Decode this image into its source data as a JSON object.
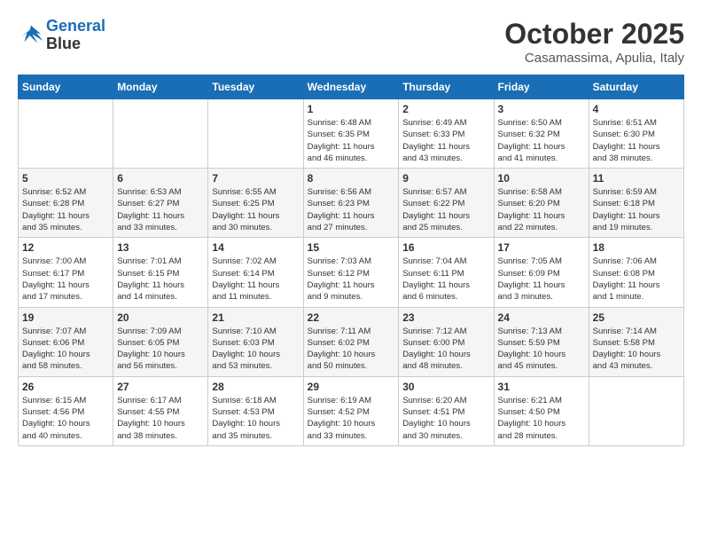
{
  "header": {
    "logo_line1": "General",
    "logo_line2": "Blue",
    "month": "October 2025",
    "location": "Casamassima, Apulia, Italy"
  },
  "weekdays": [
    "Sunday",
    "Monday",
    "Tuesday",
    "Wednesday",
    "Thursday",
    "Friday",
    "Saturday"
  ],
  "weeks": [
    [
      {
        "day": "",
        "info": ""
      },
      {
        "day": "",
        "info": ""
      },
      {
        "day": "",
        "info": ""
      },
      {
        "day": "1",
        "info": "Sunrise: 6:48 AM\nSunset: 6:35 PM\nDaylight: 11 hours\nand 46 minutes."
      },
      {
        "day": "2",
        "info": "Sunrise: 6:49 AM\nSunset: 6:33 PM\nDaylight: 11 hours\nand 43 minutes."
      },
      {
        "day": "3",
        "info": "Sunrise: 6:50 AM\nSunset: 6:32 PM\nDaylight: 11 hours\nand 41 minutes."
      },
      {
        "day": "4",
        "info": "Sunrise: 6:51 AM\nSunset: 6:30 PM\nDaylight: 11 hours\nand 38 minutes."
      }
    ],
    [
      {
        "day": "5",
        "info": "Sunrise: 6:52 AM\nSunset: 6:28 PM\nDaylight: 11 hours\nand 35 minutes."
      },
      {
        "day": "6",
        "info": "Sunrise: 6:53 AM\nSunset: 6:27 PM\nDaylight: 11 hours\nand 33 minutes."
      },
      {
        "day": "7",
        "info": "Sunrise: 6:55 AM\nSunset: 6:25 PM\nDaylight: 11 hours\nand 30 minutes."
      },
      {
        "day": "8",
        "info": "Sunrise: 6:56 AM\nSunset: 6:23 PM\nDaylight: 11 hours\nand 27 minutes."
      },
      {
        "day": "9",
        "info": "Sunrise: 6:57 AM\nSunset: 6:22 PM\nDaylight: 11 hours\nand 25 minutes."
      },
      {
        "day": "10",
        "info": "Sunrise: 6:58 AM\nSunset: 6:20 PM\nDaylight: 11 hours\nand 22 minutes."
      },
      {
        "day": "11",
        "info": "Sunrise: 6:59 AM\nSunset: 6:18 PM\nDaylight: 11 hours\nand 19 minutes."
      }
    ],
    [
      {
        "day": "12",
        "info": "Sunrise: 7:00 AM\nSunset: 6:17 PM\nDaylight: 11 hours\nand 17 minutes."
      },
      {
        "day": "13",
        "info": "Sunrise: 7:01 AM\nSunset: 6:15 PM\nDaylight: 11 hours\nand 14 minutes."
      },
      {
        "day": "14",
        "info": "Sunrise: 7:02 AM\nSunset: 6:14 PM\nDaylight: 11 hours\nand 11 minutes."
      },
      {
        "day": "15",
        "info": "Sunrise: 7:03 AM\nSunset: 6:12 PM\nDaylight: 11 hours\nand 9 minutes."
      },
      {
        "day": "16",
        "info": "Sunrise: 7:04 AM\nSunset: 6:11 PM\nDaylight: 11 hours\nand 6 minutes."
      },
      {
        "day": "17",
        "info": "Sunrise: 7:05 AM\nSunset: 6:09 PM\nDaylight: 11 hours\nand 3 minutes."
      },
      {
        "day": "18",
        "info": "Sunrise: 7:06 AM\nSunset: 6:08 PM\nDaylight: 11 hours\nand 1 minute."
      }
    ],
    [
      {
        "day": "19",
        "info": "Sunrise: 7:07 AM\nSunset: 6:06 PM\nDaylight: 10 hours\nand 58 minutes."
      },
      {
        "day": "20",
        "info": "Sunrise: 7:09 AM\nSunset: 6:05 PM\nDaylight: 10 hours\nand 56 minutes."
      },
      {
        "day": "21",
        "info": "Sunrise: 7:10 AM\nSunset: 6:03 PM\nDaylight: 10 hours\nand 53 minutes."
      },
      {
        "day": "22",
        "info": "Sunrise: 7:11 AM\nSunset: 6:02 PM\nDaylight: 10 hours\nand 50 minutes."
      },
      {
        "day": "23",
        "info": "Sunrise: 7:12 AM\nSunset: 6:00 PM\nDaylight: 10 hours\nand 48 minutes."
      },
      {
        "day": "24",
        "info": "Sunrise: 7:13 AM\nSunset: 5:59 PM\nDaylight: 10 hours\nand 45 minutes."
      },
      {
        "day": "25",
        "info": "Sunrise: 7:14 AM\nSunset: 5:58 PM\nDaylight: 10 hours\nand 43 minutes."
      }
    ],
    [
      {
        "day": "26",
        "info": "Sunrise: 6:15 AM\nSunset: 4:56 PM\nDaylight: 10 hours\nand 40 minutes."
      },
      {
        "day": "27",
        "info": "Sunrise: 6:17 AM\nSunset: 4:55 PM\nDaylight: 10 hours\nand 38 minutes."
      },
      {
        "day": "28",
        "info": "Sunrise: 6:18 AM\nSunset: 4:53 PM\nDaylight: 10 hours\nand 35 minutes."
      },
      {
        "day": "29",
        "info": "Sunrise: 6:19 AM\nSunset: 4:52 PM\nDaylight: 10 hours\nand 33 minutes."
      },
      {
        "day": "30",
        "info": "Sunrise: 6:20 AM\nSunset: 4:51 PM\nDaylight: 10 hours\nand 30 minutes."
      },
      {
        "day": "31",
        "info": "Sunrise: 6:21 AM\nSunset: 4:50 PM\nDaylight: 10 hours\nand 28 minutes."
      },
      {
        "day": "",
        "info": ""
      }
    ]
  ]
}
